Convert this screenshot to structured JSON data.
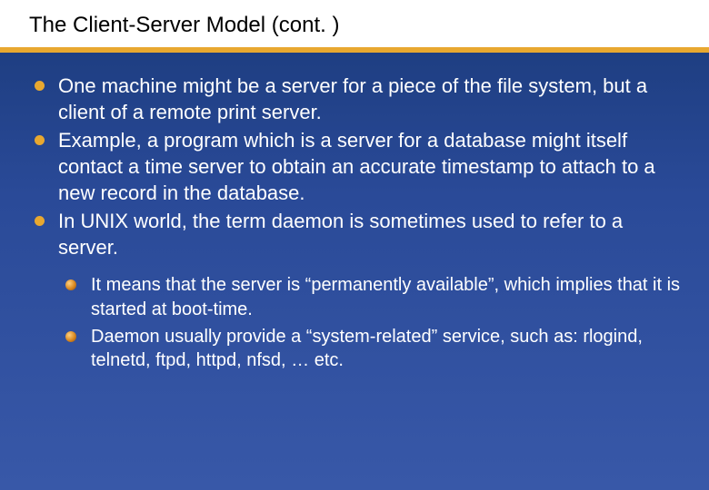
{
  "slide": {
    "title": "The Client-Server Model (cont. )",
    "bullets": [
      "One machine might be a server for a piece of the file system, but a client of a remote print server.",
      "Example, a program which is a server for a database might itself contact a time server to obtain an accurate timestamp to attach to a new record in the database.",
      "In UNIX world, the term daemon is sometimes used to refer to a server."
    ],
    "sub_bullets": [
      "It means that the server is “permanently available”, which implies that it is started at boot-time.",
      "Daemon usually provide a “system-related” service, such as: rlogind, telnetd, ftpd, httpd, nfsd, … etc."
    ]
  }
}
